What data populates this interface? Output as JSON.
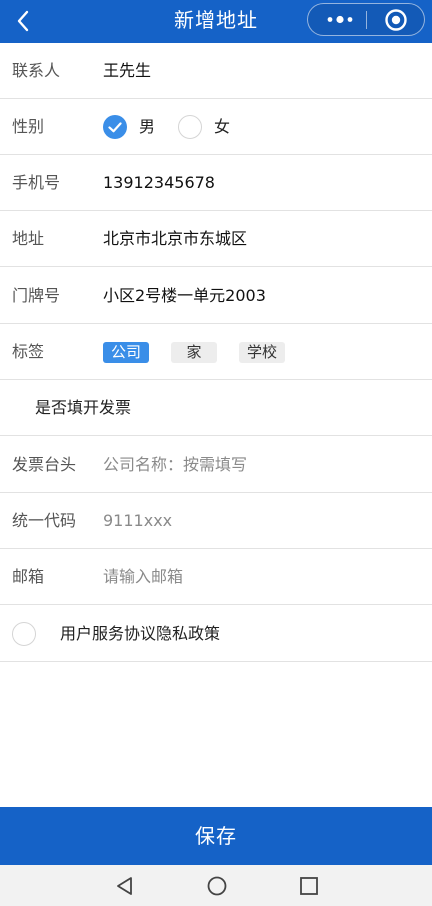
{
  "header": {
    "title": "新增地址"
  },
  "form": {
    "contact": {
      "label": "联系人",
      "value": "王先生"
    },
    "gender": {
      "label": "性别",
      "options": [
        "男",
        "女"
      ],
      "selected": "男"
    },
    "phone": {
      "label": "手机号",
      "value": "13912345678"
    },
    "address": {
      "label": "地址",
      "value": "北京市北京市东城区"
    },
    "door": {
      "label": "门牌号",
      "value": "小区2号楼一单元2003"
    },
    "tags": {
      "label": "标签",
      "items": [
        "公司",
        "家",
        "学校"
      ],
      "selected": "公司"
    },
    "invoice_toggle": {
      "label": "是否填开发票"
    },
    "invoice_title": {
      "label": "发票台头",
      "placeholder": "公司名称：按需填写"
    },
    "tax_code": {
      "label": "统一代码",
      "placeholder": "9111xxx"
    },
    "email": {
      "label": "邮箱",
      "placeholder": "请输入邮箱"
    },
    "agreement": {
      "label": "用户服务协议隐私政策"
    }
  },
  "footer": {
    "save_label": "保存"
  },
  "colors": {
    "primary": "#1562c7",
    "accent": "#3a8ee8"
  },
  "icons": [
    "back-arrow-icon",
    "more-dots-icon",
    "close-target-icon",
    "check-icon",
    "nav-back-icon",
    "nav-home-icon",
    "nav-recent-icon"
  ]
}
